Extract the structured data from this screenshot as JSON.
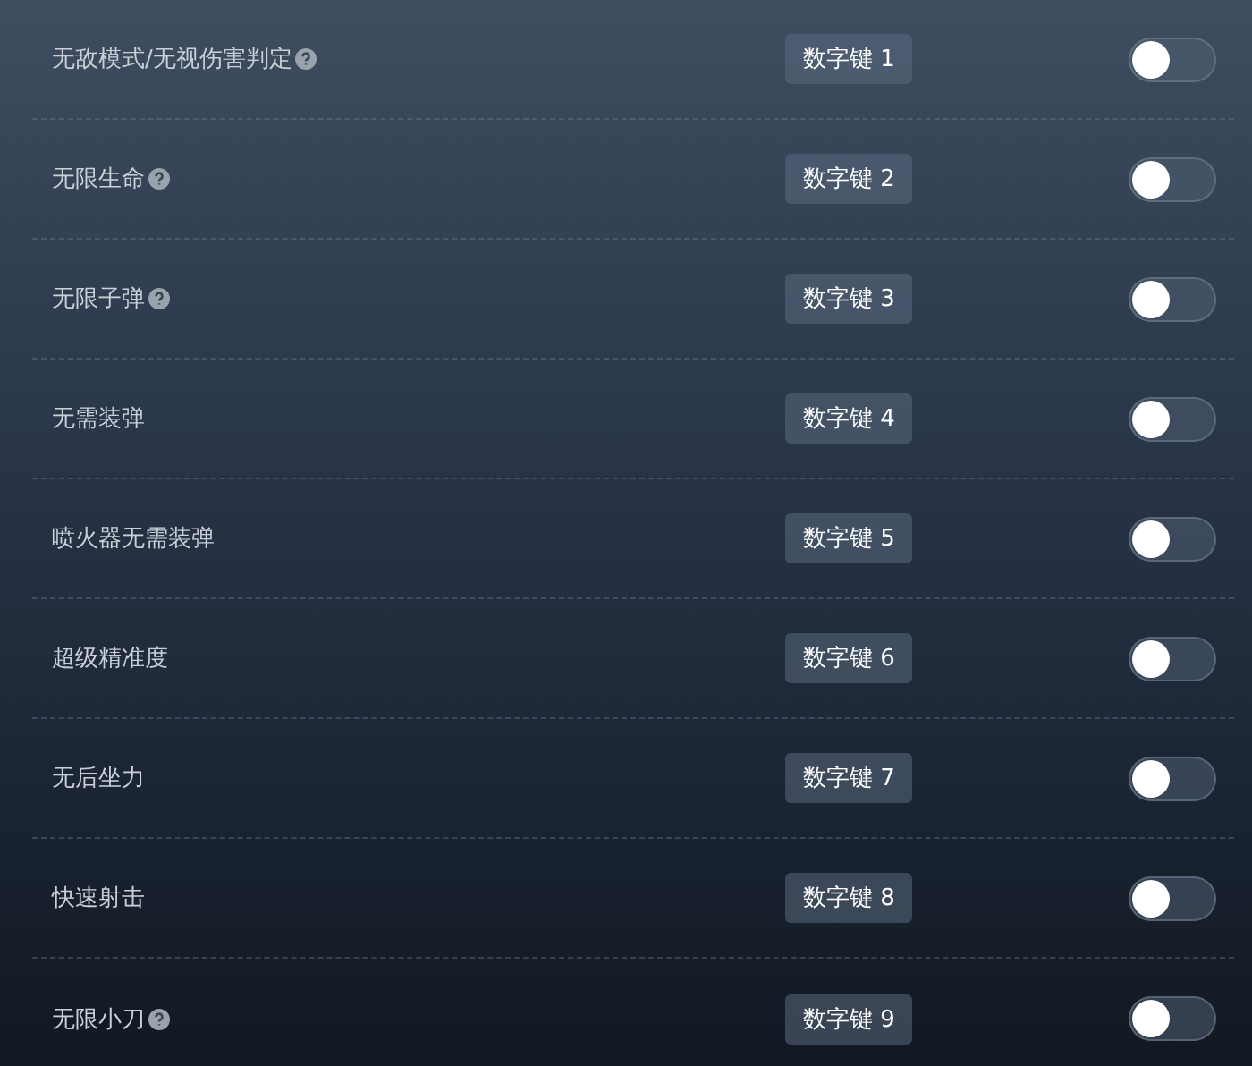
{
  "cheats": [
    {
      "label": "无敌模式/无视伤害判定",
      "help": true,
      "hotkey": "数字键 1",
      "on": false
    },
    {
      "label": "无限生命",
      "help": true,
      "hotkey": "数字键 2",
      "on": false
    },
    {
      "label": "无限子弹",
      "help": true,
      "hotkey": "数字键 3",
      "on": false
    },
    {
      "label": "无需装弹",
      "help": false,
      "hotkey": "数字键 4",
      "on": false
    },
    {
      "label": "喷火器无需装弹",
      "help": false,
      "hotkey": "数字键 5",
      "on": false
    },
    {
      "label": "超级精准度",
      "help": false,
      "hotkey": "数字键 6",
      "on": false
    },
    {
      "label": "无后坐力",
      "help": false,
      "hotkey": "数字键 7",
      "on": false
    },
    {
      "label": "快速射击",
      "help": false,
      "hotkey": "数字键 8",
      "on": false
    },
    {
      "label": "无限小刀",
      "help": true,
      "hotkey": "数字键 9",
      "on": false
    }
  ]
}
